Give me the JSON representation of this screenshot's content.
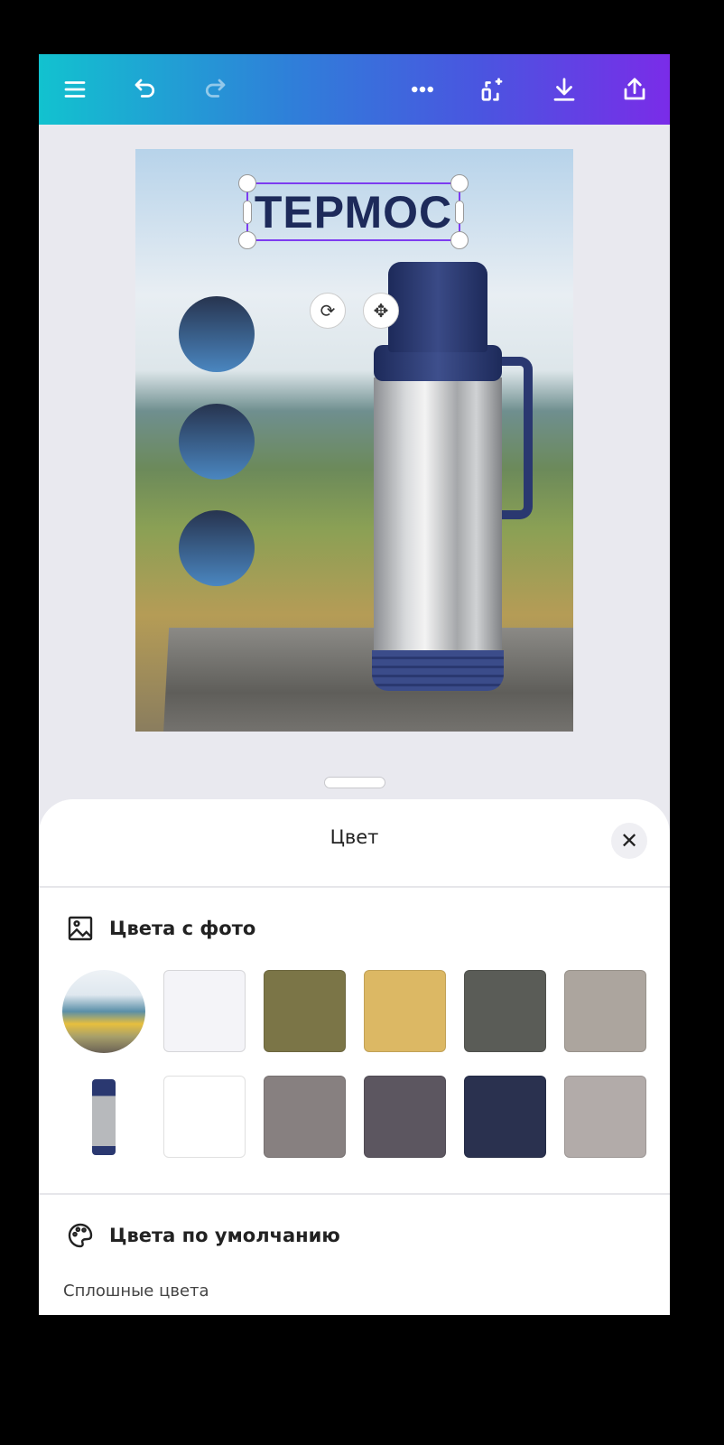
{
  "toolbar": {
    "icons": [
      "menu-icon",
      "undo-icon",
      "redo-icon",
      "more-icon",
      "magic-resize-icon",
      "download-icon",
      "share-icon"
    ]
  },
  "design": {
    "title": "ТЕРМОС",
    "circle_color": "#2f4a74"
  },
  "sheet": {
    "title": "Цвет",
    "close": "✕",
    "photo_colors": {
      "label": "Цвета с фото",
      "rows": [
        {
          "source": "landscape-photo",
          "colors": [
            "#f4f4f8",
            "#7b7547",
            "#dcb864",
            "#5a5c57",
            "#aca59e"
          ]
        },
        {
          "source": "thermos-photo",
          "colors": [
            "#ffffff",
            "#878080",
            "#5c5660",
            "#2a314f",
            "#b2aba9"
          ]
        }
      ]
    },
    "default_colors": {
      "label": "Цвета по умолчанию",
      "sub": "Сплошные цвета"
    }
  }
}
